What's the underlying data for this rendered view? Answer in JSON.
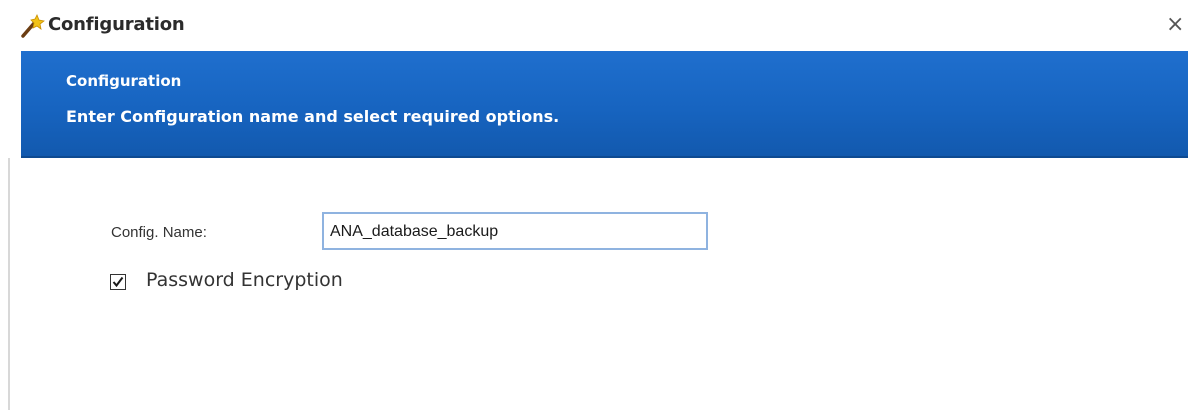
{
  "window": {
    "title": "Configuration",
    "icon": "wand-icon",
    "close_label": "×"
  },
  "banner": {
    "title": "Configuration",
    "subtitle": "Enter Configuration name and select required options.",
    "color": "#1764c0"
  },
  "form": {
    "config_name_label": "Config. Name:",
    "config_name_value": "ANA_database_backup",
    "password_encryption_label": "Password Encryption",
    "password_encryption_checked": true
  }
}
